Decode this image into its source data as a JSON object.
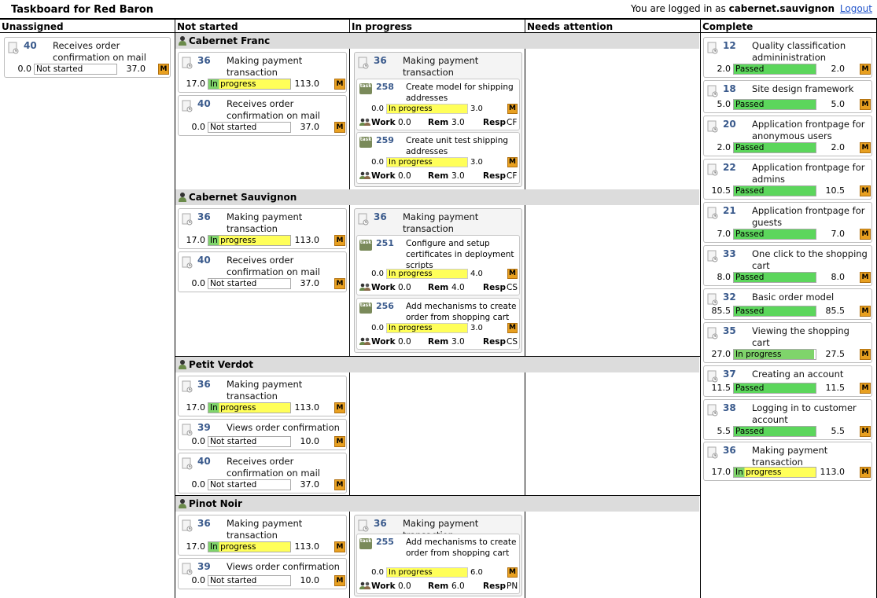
{
  "header": {
    "title": "Taskboard for Red Baron",
    "login_prefix": "You are logged in as",
    "username": "cabernet.sauvignon",
    "logout": "Logout"
  },
  "columns": [
    "Unassigned",
    "Not started",
    "In progress",
    "Needs attention",
    "Complete"
  ],
  "people": [
    "Cabernet Franc",
    "Cabernet Sauvignon",
    "Petit Verdot",
    "Pinot Noir"
  ],
  "stories": {
    "s36": {
      "id": "36",
      "name": "Making payment transaction",
      "effort": "17.0",
      "status": "In progress",
      "total": "113.0",
      "m": "M"
    },
    "s40": {
      "id": "40",
      "name": "Receives order confirmation on mail",
      "effort": "0.0",
      "status": "Not started",
      "total": "37.0",
      "m": "M"
    },
    "s39": {
      "id": "39",
      "name": "Views order confirmation",
      "effort": "0.0",
      "status": "Not started",
      "total": "10.0",
      "m": "M"
    }
  },
  "inprog_ids": {
    "s36": "36"
  },
  "tasks": {
    "t258": {
      "id": "258",
      "name": "Create model for shipping addresses",
      "effort": "0.0",
      "status": "In progress",
      "rem": "3.0",
      "m": "M",
      "work_label": "Work",
      "work": "0.0",
      "rem_label": "Rem",
      "resp_label": "Resp",
      "resp": "CF"
    },
    "t259": {
      "id": "259",
      "name": "Create unit test shipping addresses",
      "effort": "0.0",
      "status": "In progress",
      "rem": "3.0",
      "m": "M",
      "work_label": "Work",
      "work": "0.0",
      "rem_label": "Rem",
      "resp_label": "Resp",
      "resp": "CF"
    },
    "t251": {
      "id": "251",
      "name": "Configure and setup certificates in deployment scripts",
      "effort": "0.0",
      "status": "In progress",
      "rem": "4.0",
      "m": "M",
      "work_label": "Work",
      "work": "0.0",
      "rem_label": "Rem",
      "resp_label": "Resp",
      "resp": "CS"
    },
    "t256": {
      "id": "256",
      "name": "Add mechanisms to create order from shopping cart",
      "effort": "0.0",
      "status": "In progress",
      "rem": "3.0",
      "m": "M",
      "work_label": "Work",
      "work": "0.0",
      "rem_label": "Rem",
      "resp_label": "Resp",
      "resp": "CS"
    },
    "t255": {
      "id": "255",
      "name": "Add mechanisms to create order from shopping cart",
      "effort": "0.0",
      "status": "In progress",
      "rem": "6.0",
      "m": "M",
      "work_label": "Work",
      "work": "0.0",
      "rem_label": "Rem",
      "resp_label": "Resp",
      "resp": "PN"
    }
  },
  "complete": [
    {
      "id": "12",
      "name": "Quality classification admininistration",
      "effort": "2.0",
      "status": "Passed",
      "total": "2.0",
      "m": "M"
    },
    {
      "id": "18",
      "name": "Site design framework",
      "effort": "5.0",
      "status": "Passed",
      "total": "5.0",
      "m": "M"
    },
    {
      "id": "20",
      "name": "Application frontpage for anonymous users",
      "effort": "2.0",
      "status": "Passed",
      "total": "2.0",
      "m": "M"
    },
    {
      "id": "22",
      "name": "Application frontpage for admins",
      "effort": "10.5",
      "status": "Passed",
      "total": "10.5",
      "m": "M"
    },
    {
      "id": "21",
      "name": "Application frontpage for guests",
      "effort": "7.0",
      "status": "Passed",
      "total": "7.0",
      "m": "M"
    },
    {
      "id": "33",
      "name": "One click to the shopping cart",
      "effort": "8.0",
      "status": "Passed",
      "total": "8.0",
      "m": "M"
    },
    {
      "id": "32",
      "name": "Basic order model",
      "effort": "85.5",
      "status": "Passed",
      "total": "85.5",
      "m": "M"
    },
    {
      "id": "35",
      "name": "Viewing the shopping cart",
      "effort": "27.0",
      "status": "In progress",
      "total": "27.5",
      "m": "M"
    },
    {
      "id": "37",
      "name": "Creating an account",
      "effort": "11.5",
      "status": "Passed",
      "total": "11.5",
      "m": "M"
    },
    {
      "id": "38",
      "name": "Logging in to customer account",
      "effort": "5.5",
      "status": "Passed",
      "total": "5.5",
      "m": "M"
    },
    {
      "id": "36",
      "name": "Making payment transaction",
      "effort": "17.0",
      "status": "In progress",
      "total": "113.0",
      "m": "M"
    }
  ],
  "colors": {
    "in_progress": "#ffff59",
    "passed": "#5cd65c",
    "m_badge": "#e8a020",
    "id_blue": "#3a5a8c",
    "band": "#dcdcdc"
  }
}
